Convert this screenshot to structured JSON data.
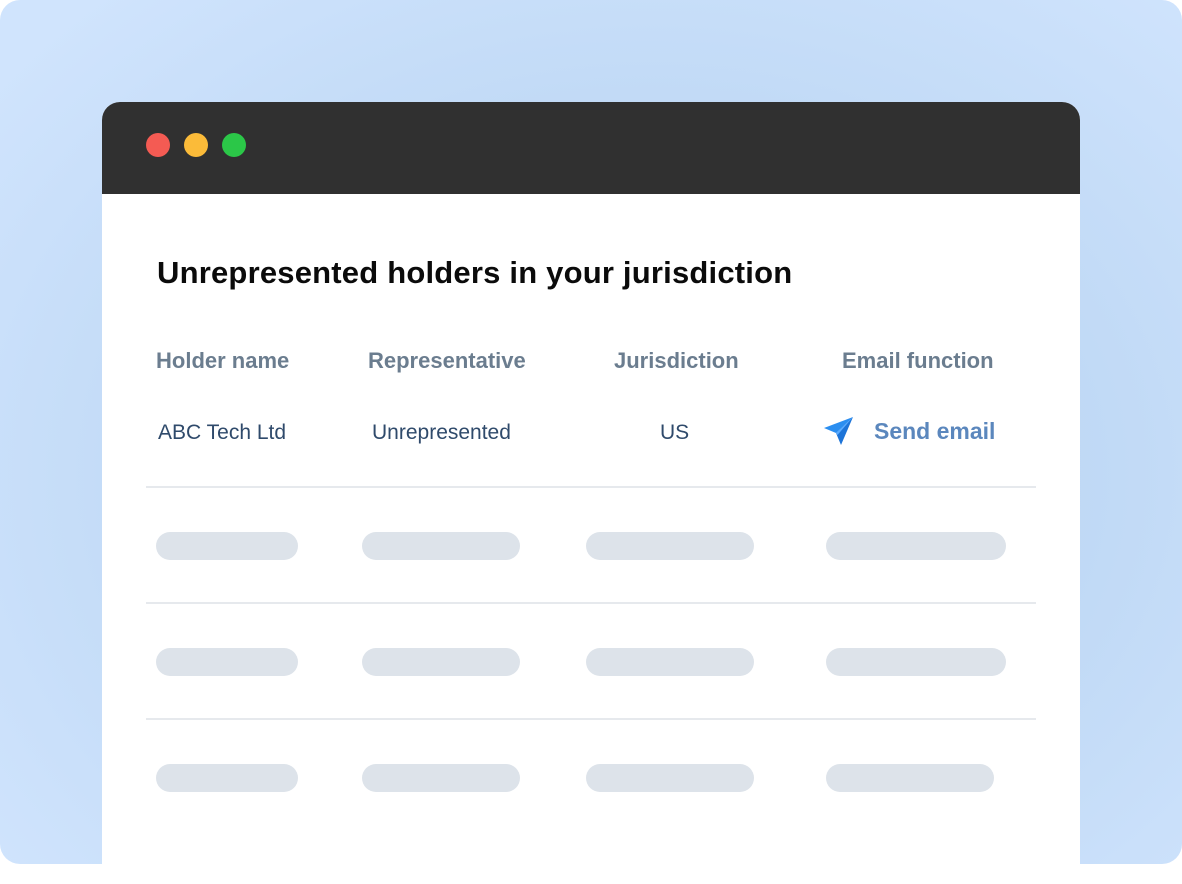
{
  "window": {
    "traffic_lights": [
      {
        "name": "close",
        "color": "#f45b53"
      },
      {
        "name": "minimize",
        "color": "#fbbb39"
      },
      {
        "name": "maximize",
        "color": "#2bc748"
      }
    ]
  },
  "page": {
    "title": "Unrepresented holders in your jurisdiction"
  },
  "table": {
    "headers": [
      "Holder name",
      "Representative",
      "Jurisdiction",
      "Email function"
    ],
    "rows": [
      {
        "holder_name": "ABC Tech Ltd",
        "representative": "Unrepresented",
        "jurisdiction": "US",
        "email_action": {
          "label": "Send email",
          "icon": "send-icon",
          "color": "#5b87bd"
        }
      }
    ],
    "placeholder_rows": 3
  },
  "colors": {
    "background": "#c4dcf6",
    "titlebar": "#303030",
    "header_text": "#6b7d8f",
    "cell_text": "#2f4a6b",
    "placeholder": "#dde3ea",
    "send_icon": "#2b8ef0"
  }
}
